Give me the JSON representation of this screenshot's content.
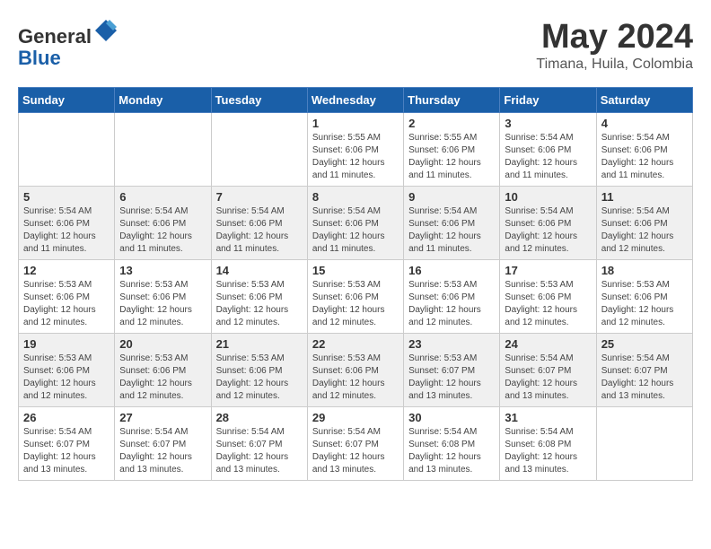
{
  "header": {
    "logo_general": "General",
    "logo_blue": "Blue",
    "month": "May 2024",
    "location": "Timana, Huila, Colombia"
  },
  "days_of_week": [
    "Sunday",
    "Monday",
    "Tuesday",
    "Wednesday",
    "Thursday",
    "Friday",
    "Saturday"
  ],
  "weeks": [
    [
      {
        "day": "",
        "info": ""
      },
      {
        "day": "",
        "info": ""
      },
      {
        "day": "",
        "info": ""
      },
      {
        "day": "1",
        "info": "Sunrise: 5:55 AM\nSunset: 6:06 PM\nDaylight: 12 hours\nand 11 minutes."
      },
      {
        "day": "2",
        "info": "Sunrise: 5:55 AM\nSunset: 6:06 PM\nDaylight: 12 hours\nand 11 minutes."
      },
      {
        "day": "3",
        "info": "Sunrise: 5:54 AM\nSunset: 6:06 PM\nDaylight: 12 hours\nand 11 minutes."
      },
      {
        "day": "4",
        "info": "Sunrise: 5:54 AM\nSunset: 6:06 PM\nDaylight: 12 hours\nand 11 minutes."
      }
    ],
    [
      {
        "day": "5",
        "info": "Sunrise: 5:54 AM\nSunset: 6:06 PM\nDaylight: 12 hours\nand 11 minutes."
      },
      {
        "day": "6",
        "info": "Sunrise: 5:54 AM\nSunset: 6:06 PM\nDaylight: 12 hours\nand 11 minutes."
      },
      {
        "day": "7",
        "info": "Sunrise: 5:54 AM\nSunset: 6:06 PM\nDaylight: 12 hours\nand 11 minutes."
      },
      {
        "day": "8",
        "info": "Sunrise: 5:54 AM\nSunset: 6:06 PM\nDaylight: 12 hours\nand 11 minutes."
      },
      {
        "day": "9",
        "info": "Sunrise: 5:54 AM\nSunset: 6:06 PM\nDaylight: 12 hours\nand 11 minutes."
      },
      {
        "day": "10",
        "info": "Sunrise: 5:54 AM\nSunset: 6:06 PM\nDaylight: 12 hours\nand 12 minutes."
      },
      {
        "day": "11",
        "info": "Sunrise: 5:54 AM\nSunset: 6:06 PM\nDaylight: 12 hours\nand 12 minutes."
      }
    ],
    [
      {
        "day": "12",
        "info": "Sunrise: 5:53 AM\nSunset: 6:06 PM\nDaylight: 12 hours\nand 12 minutes."
      },
      {
        "day": "13",
        "info": "Sunrise: 5:53 AM\nSunset: 6:06 PM\nDaylight: 12 hours\nand 12 minutes."
      },
      {
        "day": "14",
        "info": "Sunrise: 5:53 AM\nSunset: 6:06 PM\nDaylight: 12 hours\nand 12 minutes."
      },
      {
        "day": "15",
        "info": "Sunrise: 5:53 AM\nSunset: 6:06 PM\nDaylight: 12 hours\nand 12 minutes."
      },
      {
        "day": "16",
        "info": "Sunrise: 5:53 AM\nSunset: 6:06 PM\nDaylight: 12 hours\nand 12 minutes."
      },
      {
        "day": "17",
        "info": "Sunrise: 5:53 AM\nSunset: 6:06 PM\nDaylight: 12 hours\nand 12 minutes."
      },
      {
        "day": "18",
        "info": "Sunrise: 5:53 AM\nSunset: 6:06 PM\nDaylight: 12 hours\nand 12 minutes."
      }
    ],
    [
      {
        "day": "19",
        "info": "Sunrise: 5:53 AM\nSunset: 6:06 PM\nDaylight: 12 hours\nand 12 minutes."
      },
      {
        "day": "20",
        "info": "Sunrise: 5:53 AM\nSunset: 6:06 PM\nDaylight: 12 hours\nand 12 minutes."
      },
      {
        "day": "21",
        "info": "Sunrise: 5:53 AM\nSunset: 6:06 PM\nDaylight: 12 hours\nand 12 minutes."
      },
      {
        "day": "22",
        "info": "Sunrise: 5:53 AM\nSunset: 6:06 PM\nDaylight: 12 hours\nand 12 minutes."
      },
      {
        "day": "23",
        "info": "Sunrise: 5:53 AM\nSunset: 6:07 PM\nDaylight: 12 hours\nand 13 minutes."
      },
      {
        "day": "24",
        "info": "Sunrise: 5:54 AM\nSunset: 6:07 PM\nDaylight: 12 hours\nand 13 minutes."
      },
      {
        "day": "25",
        "info": "Sunrise: 5:54 AM\nSunset: 6:07 PM\nDaylight: 12 hours\nand 13 minutes."
      }
    ],
    [
      {
        "day": "26",
        "info": "Sunrise: 5:54 AM\nSunset: 6:07 PM\nDaylight: 12 hours\nand 13 minutes."
      },
      {
        "day": "27",
        "info": "Sunrise: 5:54 AM\nSunset: 6:07 PM\nDaylight: 12 hours\nand 13 minutes."
      },
      {
        "day": "28",
        "info": "Sunrise: 5:54 AM\nSunset: 6:07 PM\nDaylight: 12 hours\nand 13 minutes."
      },
      {
        "day": "29",
        "info": "Sunrise: 5:54 AM\nSunset: 6:07 PM\nDaylight: 12 hours\nand 13 minutes."
      },
      {
        "day": "30",
        "info": "Sunrise: 5:54 AM\nSunset: 6:08 PM\nDaylight: 12 hours\nand 13 minutes."
      },
      {
        "day": "31",
        "info": "Sunrise: 5:54 AM\nSunset: 6:08 PM\nDaylight: 12 hours\nand 13 minutes."
      },
      {
        "day": "",
        "info": ""
      }
    ]
  ]
}
